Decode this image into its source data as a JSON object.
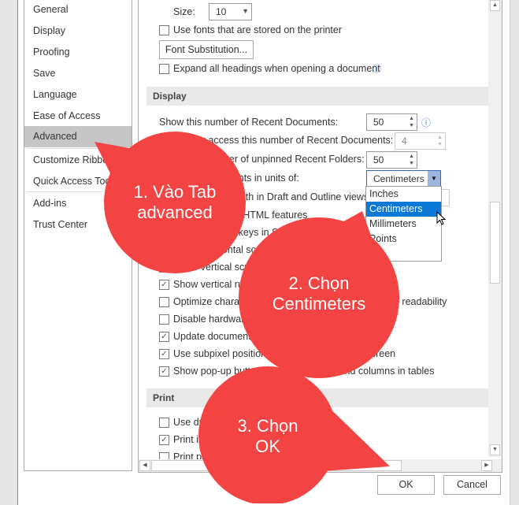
{
  "sidebar": {
    "items": [
      {
        "label": "General"
      },
      {
        "label": "Display"
      },
      {
        "label": "Proofing"
      },
      {
        "label": "Save"
      },
      {
        "label": "Language"
      },
      {
        "label": "Ease of Access"
      },
      {
        "label": "Advanced",
        "selected": true
      },
      {
        "label": "Customize Ribbon"
      },
      {
        "label": "Quick Access Toolbar"
      },
      {
        "label": "Add-ins"
      },
      {
        "label": "Trust Center"
      }
    ]
  },
  "main": {
    "size_label": "Size:",
    "size_value": "10",
    "use_printer_fonts": {
      "label": "Use fonts that are stored on the printer",
      "checked": false
    },
    "font_substitution_button": "Font Substitution...",
    "expand_headings": {
      "label": "Expand all headings when opening a document",
      "checked": false
    },
    "display": {
      "header": "Display",
      "recent_docs_label": "Show this number of Recent Documents:",
      "recent_docs_value": "50",
      "quick_access_label": "Quickly access this number of Recent Documents:",
      "quick_access_value": "4",
      "recent_folders_label": "Show this number of unpinned Recent Folders:",
      "recent_folders_value": "50",
      "units_label": "Show measurements in units of:",
      "units_value": "Centimeters",
      "style_area_label": "Style area pane width in Draft and Outline views:",
      "units_options": [
        "Inches",
        "Centimeters",
        "Millimeters",
        "Points"
      ],
      "checkboxes": [
        {
          "label": "Show pixels for HTML features",
          "checked": false
        },
        {
          "label": "Show shortcut keys in ScreenTips",
          "checked": true
        },
        {
          "label": "Show horizontal scroll bar",
          "checked": true
        },
        {
          "label": "Show vertical scroll bar",
          "checked": true
        },
        {
          "label": "Show vertical ruler in Print Layout view",
          "checked": true
        },
        {
          "label": "Optimize character positioning for layout rather than readability",
          "checked": false
        },
        {
          "label": "Disable hardware graphics acceleration",
          "checked": false
        },
        {
          "label": "Update document content while dragging",
          "checked": true
        },
        {
          "label": "Use subpixel positioning to smooth fonts on screen",
          "checked": true
        },
        {
          "label": "Show pop-up buttons for adding rows and columns in tables",
          "checked": true
        }
      ]
    },
    "print": {
      "header": "Print",
      "checkboxes": [
        {
          "label": "Use draft quality",
          "checked": false
        },
        {
          "label": "Print in background",
          "checked": true
        },
        {
          "label": "Print pages in reverse order",
          "checked": false
        }
      ]
    }
  },
  "footer": {
    "ok": "OK",
    "cancel": "Cancel"
  },
  "callouts": [
    {
      "line1": "1. Vào Tab",
      "line2": "advanced"
    },
    {
      "line1": "2. Chọn",
      "line2": "Centimeters"
    },
    {
      "line1": "3. Chọn",
      "line2": "OK"
    }
  ],
  "colors": {
    "callout": "#f44343",
    "selection": "#0a78d7",
    "sidebar_selected": "#c6c6c6"
  }
}
